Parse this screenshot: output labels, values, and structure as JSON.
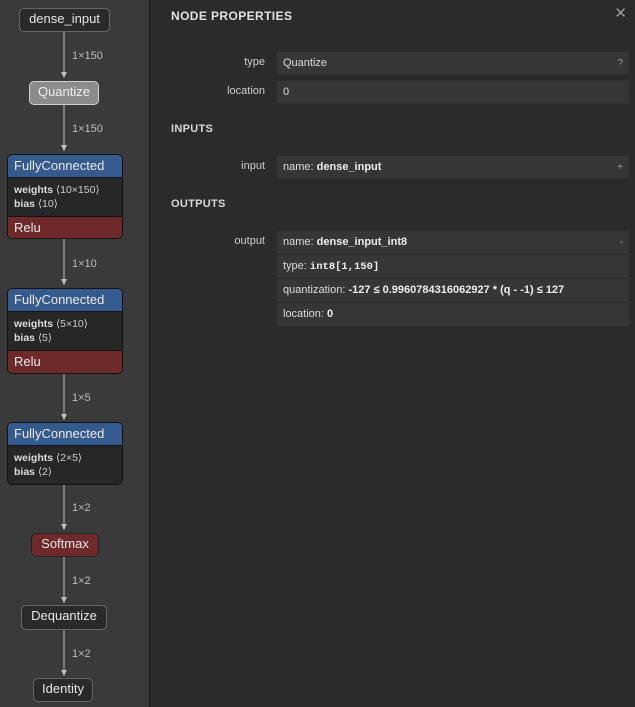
{
  "graph": {
    "nodes": {
      "dense_input": "dense_input",
      "quantize": "Quantize",
      "fc1": {
        "title": "FullyConnected",
        "weights_label": "weights",
        "weights_shape": "⟨10×150⟩",
        "bias_label": "bias",
        "bias_shape": "⟨10⟩",
        "activation": "Relu"
      },
      "fc2": {
        "title": "FullyConnected",
        "weights_label": "weights",
        "weights_shape": "⟨5×10⟩",
        "bias_label": "bias",
        "bias_shape": "⟨5⟩",
        "activation": "Relu"
      },
      "fc3": {
        "title": "FullyConnected",
        "weights_label": "weights",
        "weights_shape": "⟨2×5⟩",
        "bias_label": "bias",
        "bias_shape": "⟨2⟩"
      },
      "softmax": "Softmax",
      "dequantize": "Dequantize",
      "identity": "Identity"
    },
    "edges": [
      "1×150",
      "1×150",
      "1×10",
      "1×5",
      "1×2",
      "1×2",
      "1×2"
    ]
  },
  "sidebar": {
    "title": "NODE PROPERTIES",
    "close_icon": "✕",
    "properties": {
      "type_label": "type",
      "type_value": "Quantize",
      "type_help": "?",
      "location_label": "location",
      "location_value": "0"
    },
    "inputs": {
      "heading": "INPUTS",
      "label": "input",
      "name_prefix": "name:",
      "name_value": "dense_input",
      "expand": "+"
    },
    "outputs": {
      "heading": "OUTPUTS",
      "label": "output",
      "name_prefix": "name:",
      "name_value": "dense_input_int8",
      "collapse": "-",
      "type_prefix": "type:",
      "type_value": "int8[1,150]",
      "quant_prefix": "quantization:",
      "quant_value": "-127 ≤ 0.9960784316062927 * (q - -1) ≤ 127",
      "location_prefix": "location:",
      "location_value": "0"
    }
  }
}
